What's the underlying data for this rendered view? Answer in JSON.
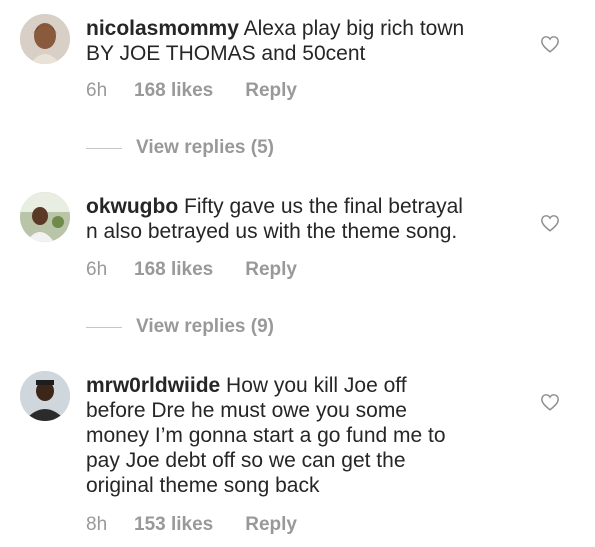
{
  "comments": [
    {
      "username": "nicolasmommy",
      "text": " Alexa play big rich town\nBY JOE THOMAS and 50cent",
      "time": "6h",
      "likes": "168 likes",
      "reply": "Reply",
      "view_replies": "View replies (5)"
    },
    {
      "username": "okwugbo",
      "text": " Fifty gave us the final betrayal\nn also betrayed us with the theme song.",
      "time": "6h",
      "likes": "168 likes",
      "reply": "Reply",
      "view_replies": "View replies (9)"
    },
    {
      "username": "mrw0rldwiide",
      "text": " How you kill Joe off\nbefore Dre he must owe you some\nmoney I’m gonna start a go fund me to\npay Joe debt off so we can get the\noriginal theme song back",
      "time": "8h",
      "likes": "153 likes",
      "reply": "Reply"
    }
  ],
  "icons": {
    "like": "heart-outline-icon"
  },
  "colors": {
    "text": "#262626",
    "meta": "#999999",
    "divider": "#c7c7c7"
  }
}
